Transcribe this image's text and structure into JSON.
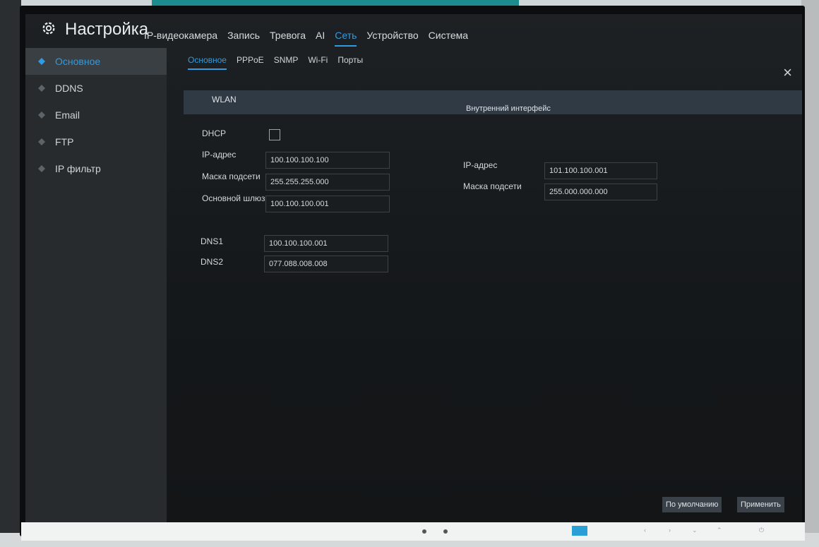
{
  "app": {
    "title": "Настройка",
    "icon": "gear-icon"
  },
  "topnav": [
    {
      "label": "IP-видеокамера",
      "active": false
    },
    {
      "label": "Запись",
      "active": false
    },
    {
      "label": "Тревога",
      "active": false
    },
    {
      "label": "AI",
      "active": false
    },
    {
      "label": "Сеть",
      "active": true
    },
    {
      "label": "Устройство",
      "active": false
    },
    {
      "label": "Система",
      "active": false
    }
  ],
  "close": {
    "label": "×"
  },
  "sidebar": {
    "items": [
      {
        "label": "Основное",
        "active": true
      },
      {
        "label": "DDNS",
        "active": false
      },
      {
        "label": "Email",
        "active": false
      },
      {
        "label": "FTP",
        "active": false
      },
      {
        "label": "IP фильтр",
        "active": false
      }
    ]
  },
  "subtabs": [
    {
      "label": "Основное",
      "active": true
    },
    {
      "label": "PPPoE",
      "active": false
    },
    {
      "label": "SNMP",
      "active": false
    },
    {
      "label": "Wi-Fi",
      "active": false
    },
    {
      "label": "Порты",
      "active": false
    }
  ],
  "section": {
    "wlan": "WLAN",
    "interface": "Внутренний интерфейс"
  },
  "wlan": {
    "dhcp_label": "DHCP",
    "dhcp_checked": false,
    "ip_label": "IP-адрес",
    "ip_value": "100.100.100.100",
    "mask_label": "Маска подсети",
    "mask_value": "255.255.255.000",
    "gateway_label": "Основной шлюз",
    "gateway_value": "100.100.100.001",
    "dns1_label": "DNS1",
    "dns1_value": "100.100.100.001",
    "dns2_label": "DNS2",
    "dns2_value": "077.088.008.008"
  },
  "internal": {
    "ip_label": "IP-адрес",
    "ip_value": "101.100.100.001",
    "mask_label": "Маска подсети",
    "mask_value": "255.000.000.000"
  },
  "buttons": {
    "default": "По умолчанию",
    "apply": "Применить"
  },
  "colors": {
    "accent": "#2f9be0",
    "sidebar_bg": "#272b2e",
    "section_bar": "#2f3a44"
  }
}
